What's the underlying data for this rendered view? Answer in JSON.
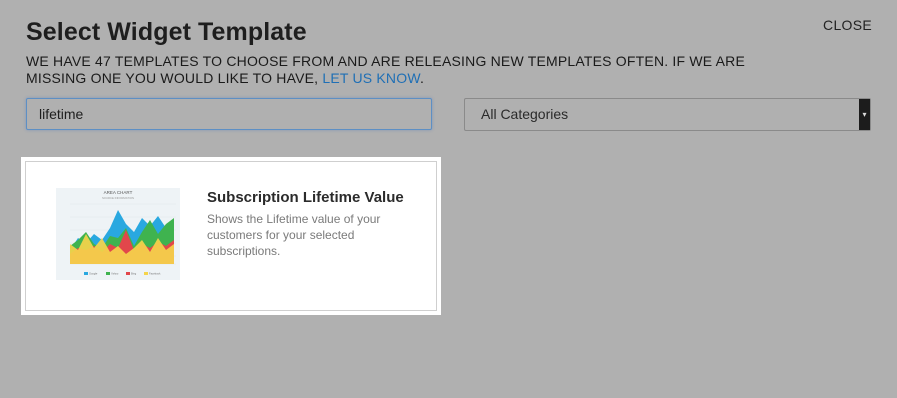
{
  "modal": {
    "title": "Select Widget Template",
    "close_label": "CLOSE",
    "intro_text": "WE HAVE 47 TEMPLATES TO CHOOSE FROM AND ARE RELEASING NEW TEMPLATES OFTEN. IF WE ARE MISSING ONE YOU WOULD LIKE TO HAVE, ",
    "intro_link": "LET US KNOW",
    "intro_end": "."
  },
  "search": {
    "value": "lifetime",
    "placeholder": ""
  },
  "category_select": {
    "selected": "All Categories",
    "arrow_icon": "caret-down-icon"
  },
  "templates": [
    {
      "title": "Subscription Lifetime Value",
      "description": "Shows the Lifetime value of your customers for your selected subscriptions.",
      "thumbnail": {
        "chart_title": "AREA CHART",
        "chart_subtitle": "SOURCE INFORMATION",
        "legend": [
          "Google",
          "Yahoo",
          "Bing",
          "Facebook"
        ],
        "colors": [
          "#29a8e0",
          "#3fb34f",
          "#e2474b",
          "#f5d44b"
        ]
      }
    }
  ]
}
